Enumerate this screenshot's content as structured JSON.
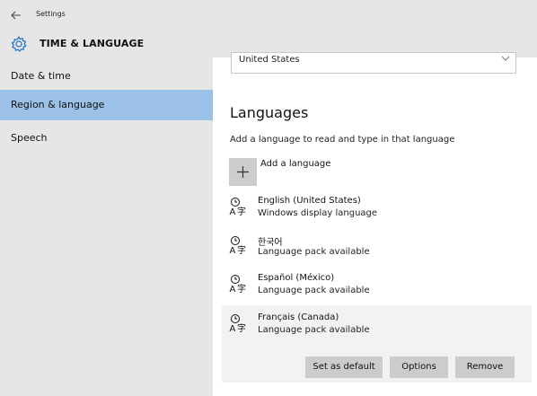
{
  "window": {
    "title": "Settings",
    "back_icon": "back-arrow-icon"
  },
  "sidebar": {
    "header_icon": "gear-icon",
    "header_label": "TIME & LANGUAGE",
    "items": [
      {
        "label": "Date & time",
        "selected": false
      },
      {
        "label": "Region & language",
        "selected": true
      },
      {
        "label": "Speech",
        "selected": false
      }
    ],
    "selected_color": "#9bc2e6"
  },
  "region": {
    "country_value": "United States"
  },
  "languages": {
    "title": "Languages",
    "description": "Add a language to read and type in that language",
    "add_label": "Add a language",
    "items": [
      {
        "name": "English (United States)",
        "status": "Windows display language"
      },
      {
        "name": "한국어",
        "status": "Language pack available"
      },
      {
        "name": "Español (México)",
        "status": "Language pack available"
      },
      {
        "name": "Français (Canada)",
        "status": "Language pack available",
        "selected": true
      }
    ],
    "actions": {
      "set_default": "Set as default",
      "options": "Options",
      "remove": "Remove"
    }
  }
}
